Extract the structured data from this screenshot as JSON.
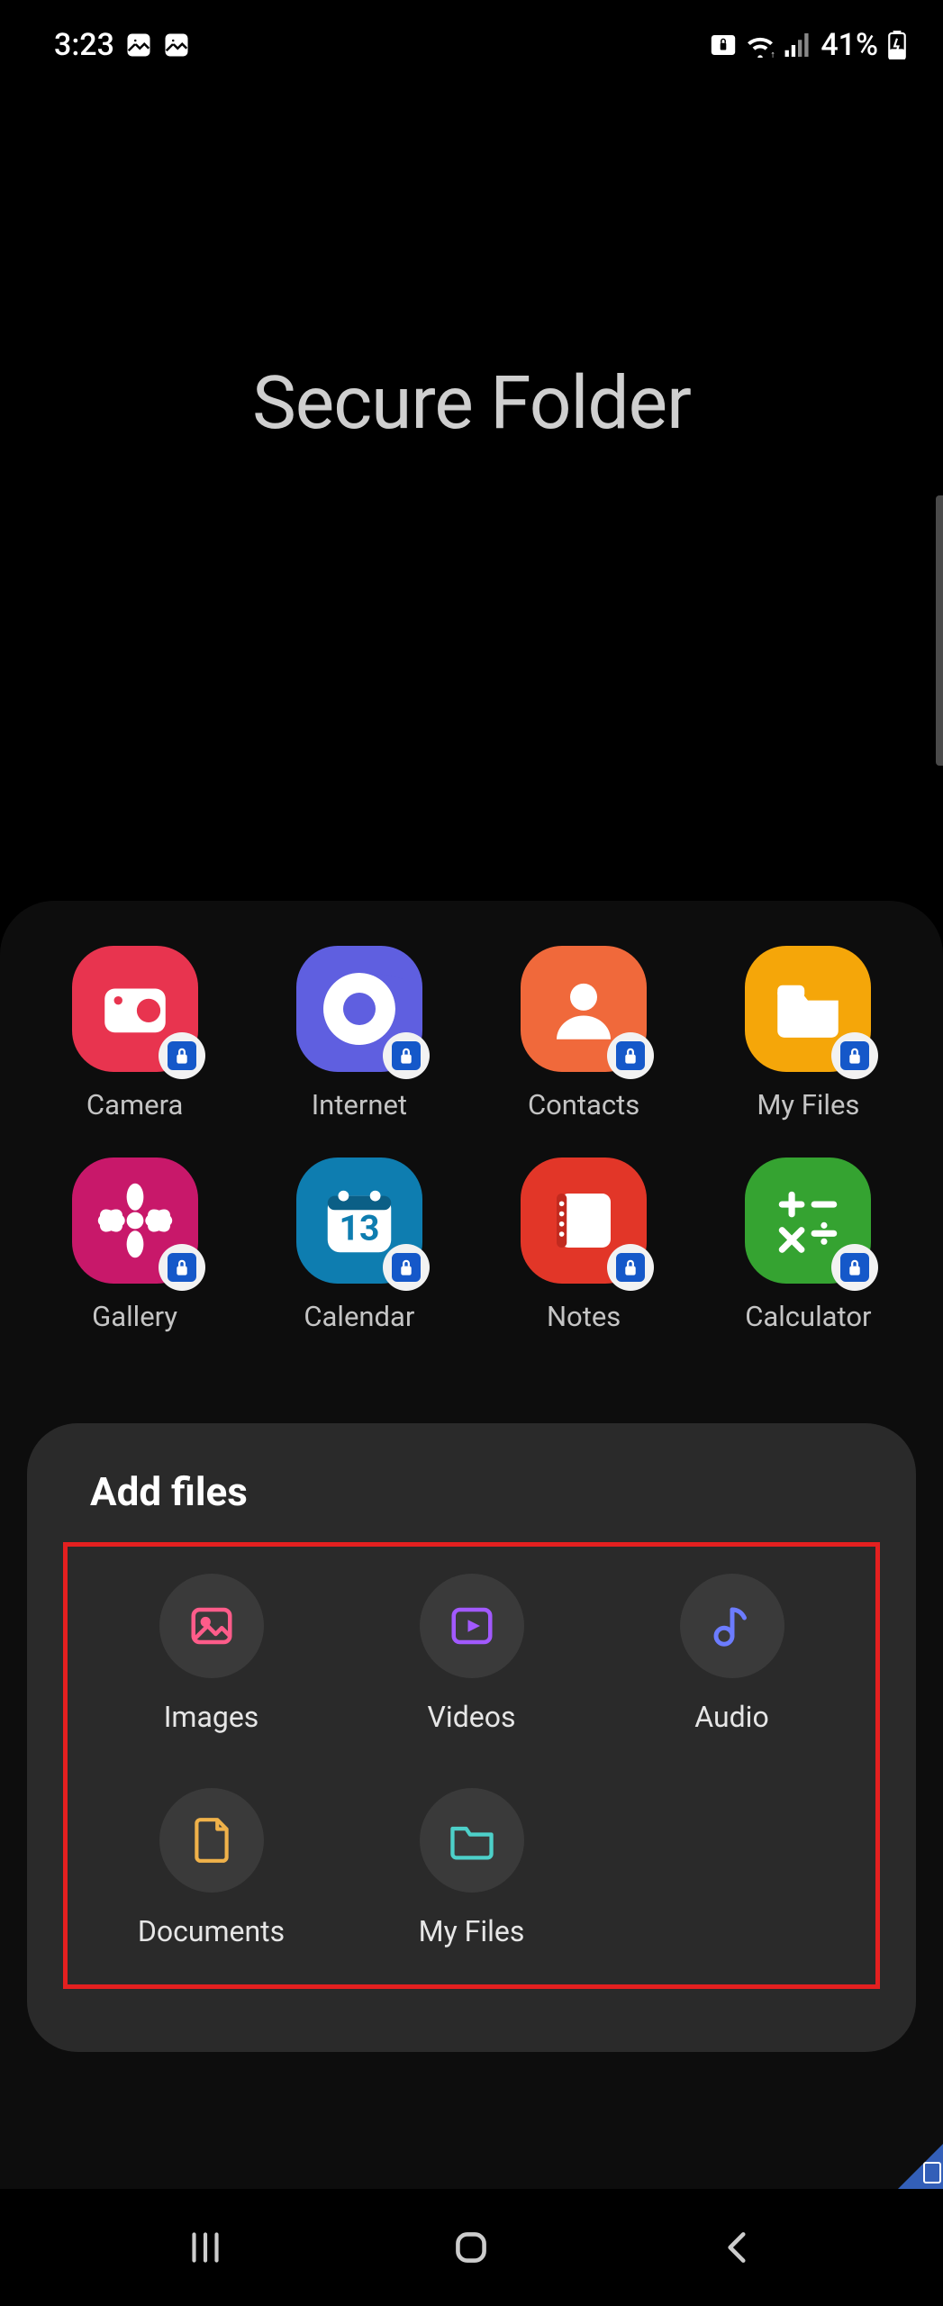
{
  "status_bar": {
    "time": "3:23",
    "battery_text": "41%"
  },
  "page": {
    "title": "Secure Folder"
  },
  "apps": [
    {
      "label": "Camera",
      "color": "#e8344f",
      "icon": "camera"
    },
    {
      "label": "Internet",
      "color": "#5f5fe0",
      "icon": "internet"
    },
    {
      "label": "Contacts",
      "color": "#f0693b",
      "icon": "contacts"
    },
    {
      "label": "My Files",
      "color": "#f5a609",
      "icon": "myfiles"
    },
    {
      "label": "Gallery",
      "color": "#c8186a",
      "icon": "gallery"
    },
    {
      "label": "Calendar",
      "color": "#0e7db0",
      "icon": "calendar",
      "badge_text": "13"
    },
    {
      "label": "Notes",
      "color": "#e23628",
      "icon": "notes"
    },
    {
      "label": "Calculator",
      "color": "#35a331",
      "icon": "calculator"
    }
  ],
  "sheet": {
    "title": "Add files",
    "items": [
      {
        "label": "Images",
        "icon": "images",
        "color": "#ff5c8a"
      },
      {
        "label": "Videos",
        "icon": "videos",
        "color": "#a259ff"
      },
      {
        "label": "Audio",
        "icon": "audio",
        "color": "#6c7cff"
      },
      {
        "label": "Documents",
        "icon": "documents",
        "color": "#f0b24a"
      },
      {
        "label": "My Files",
        "icon": "folder",
        "color": "#4dd0c9"
      }
    ]
  }
}
